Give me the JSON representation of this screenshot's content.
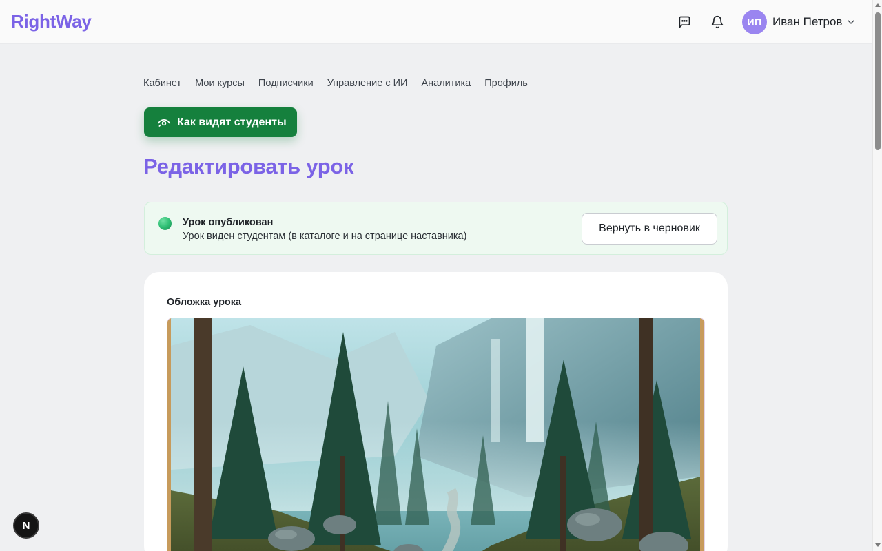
{
  "header": {
    "logo": "RightWay",
    "messages_icon": "message-square-icon",
    "notifications_icon": "bell-icon",
    "avatar_initials": "ИП",
    "user_name": "Иван Петров",
    "user_menu_icon": "chevron-down-icon"
  },
  "nav": {
    "items": [
      {
        "label": "Кабинет"
      },
      {
        "label": "Мои курсы"
      },
      {
        "label": "Подписчики"
      },
      {
        "label": "Управление с ИИ"
      },
      {
        "label": "Аналитика"
      },
      {
        "label": "Профиль"
      }
    ]
  },
  "preview_button": {
    "label": "Как видят студенты",
    "icon": "eye-icon"
  },
  "page": {
    "title": "Редактировать урок"
  },
  "status": {
    "title": "Урок опубликован",
    "description": "Урок виден студентам (в каталоге и на странице наставника)",
    "action_label": "Вернуть в черновик",
    "color": "#2fbf74"
  },
  "cover": {
    "label": "Обложка урока"
  },
  "floating": {
    "label": "N"
  },
  "colors": {
    "brand": "#7b63e6",
    "primary_button": "#15803d",
    "status_bg": "#eef9f1"
  }
}
